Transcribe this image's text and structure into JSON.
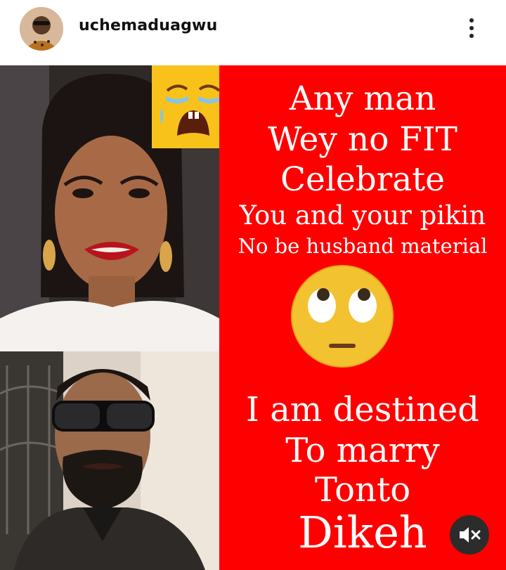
{
  "header": {
    "username": "uchemaduagwu",
    "avatar_icon": "profile-avatar",
    "more_icon": "more-vertical-icon"
  },
  "post": {
    "lines": [
      "Any man",
      "Wey no FIT",
      "Celebrate",
      "You and your pikin",
      "No be husband material",
      "I am destined",
      "To marry",
      "Tonto",
      "Dikeh"
    ],
    "emoji_top": "crying-face-icon",
    "emoji_middle": "face-with-rolling-eyes-icon",
    "mute_icon": "speaker-muted-icon",
    "colors": {
      "panel": "#ff0000",
      "text": "#ffffff",
      "emoji": "#f9c21b"
    }
  }
}
